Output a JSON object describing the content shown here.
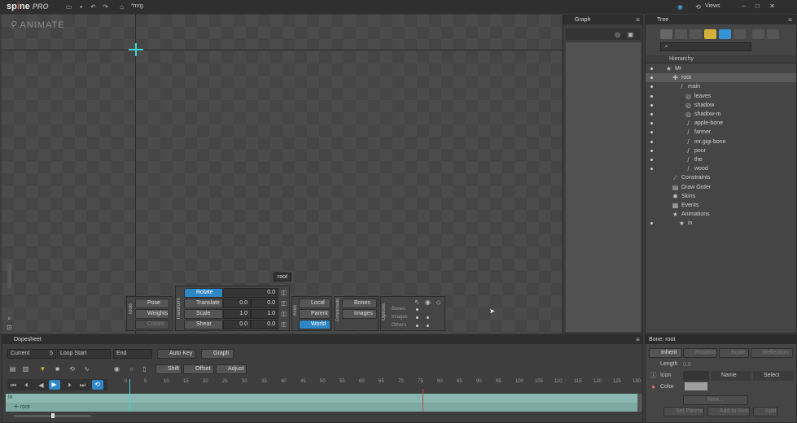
{
  "app": {
    "logo_a": "sp",
    "logo_b": "ne",
    "pro": "PRO",
    "file": "*mrg",
    "views": "Views"
  },
  "viewport": {
    "mode": "ANIMATE",
    "bone_tag": "root"
  },
  "tools": {
    "section": "Tools",
    "pose": "Pose",
    "weights": "Weights",
    "create": "Create",
    "transform_section": "Transform",
    "rows": [
      {
        "label": "Rotate",
        "a": "0.0",
        "b": ""
      },
      {
        "label": "Translate",
        "a": "0.0",
        "b": "0.0"
      },
      {
        "label": "Scale",
        "a": "1.0",
        "b": "1.0"
      },
      {
        "label": "Shear",
        "a": "0.0",
        "b": "0.0"
      }
    ],
    "axes_section": "Axes",
    "local": "Local",
    "parent": "Parent",
    "world": "World",
    "comp_section": "Compensate",
    "bones": "Bones",
    "images": "Images",
    "opt_section": "Options",
    "opt_rows": [
      "Bones",
      "Images",
      "Others"
    ]
  },
  "graph": {
    "title": "Graph"
  },
  "tree": {
    "title": "Tree",
    "hierarchy": "Hierarchy",
    "items": [
      {
        "label": "Mr",
        "indent": 14,
        "eye": true,
        "icon": "★"
      },
      {
        "label": "root",
        "indent": 22,
        "eye": true,
        "icon": "✚",
        "selected": true
      },
      {
        "label": "main",
        "indent": 30,
        "eye": true,
        "icon": "/"
      },
      {
        "label": "leaves",
        "indent": 38,
        "eye": true,
        "icon": "◎"
      },
      {
        "label": "shadow",
        "indent": 38,
        "eye": true,
        "icon": "◎"
      },
      {
        "label": "shadow-m",
        "indent": 38,
        "eye": true,
        "icon": "◎"
      },
      {
        "label": "apple-bone",
        "indent": 38,
        "eye": true,
        "icon": "/"
      },
      {
        "label": "farmer",
        "indent": 38,
        "eye": true,
        "icon": "/"
      },
      {
        "label": "mr.gigi-bone",
        "indent": 38,
        "eye": true,
        "icon": "/"
      },
      {
        "label": "pour",
        "indent": 38,
        "eye": true,
        "icon": "/"
      },
      {
        "label": "the",
        "indent": 38,
        "eye": true,
        "icon": "/"
      },
      {
        "label": "wood",
        "indent": 38,
        "eye": true,
        "icon": "/"
      },
      {
        "label": "Constraints",
        "indent": 22,
        "eye": false,
        "icon": "∕"
      },
      {
        "label": "Draw Order",
        "indent": 22,
        "eye": false,
        "icon": "▤"
      },
      {
        "label": "Skins",
        "indent": 22,
        "eye": false,
        "icon": "✹"
      },
      {
        "label": "Events",
        "indent": 22,
        "eye": false,
        "icon": "▦"
      },
      {
        "label": "Animations",
        "indent": 22,
        "eye": false,
        "icon": "★"
      },
      {
        "label": "in",
        "indent": 30,
        "eye": true,
        "icon": "★"
      }
    ]
  },
  "bone": {
    "title": "Bone: root",
    "inherit": "Inherit",
    "rotation": "Rotation",
    "scale": "Scale",
    "reflection": "Reflection",
    "length": "Length",
    "length_val": "0.0",
    "icon": "Icon",
    "name": "Name",
    "select": "Select",
    "color": "Color",
    "new": "New...",
    "set_parent": "Set Parent",
    "add_to_skin": "Add to Skin",
    "split": "Split"
  },
  "dopesheet": {
    "title": "Dopesheet",
    "current": "Current",
    "current_val": "5",
    "loop_start": "Loop Start",
    "end": "End",
    "auto_key": "Auto Key",
    "graph": "Graph",
    "shift": "Shift",
    "offset": "Offset",
    "adjust": "Adjust",
    "ticks": [
      "0",
      "5",
      "10",
      "15",
      "20",
      "25",
      "30",
      "35",
      "40",
      "45",
      "50",
      "55",
      "60",
      "65",
      "70",
      "75",
      "80",
      "85",
      "90",
      "95",
      "100",
      "105",
      "110",
      "115",
      "120",
      "125",
      "130"
    ],
    "rows": [
      {
        "label": "in"
      },
      {
        "label": "root"
      }
    ]
  }
}
